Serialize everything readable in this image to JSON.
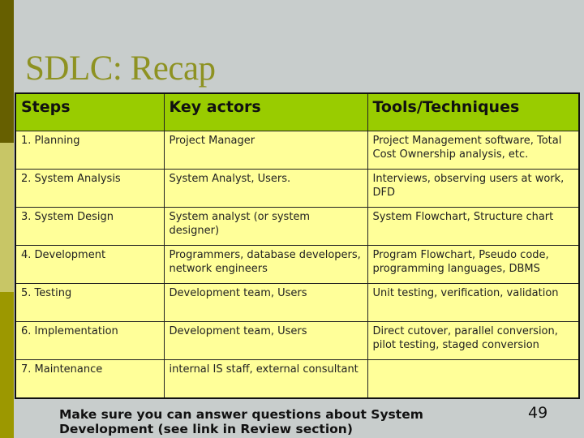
{
  "slide": {
    "title": "SDLC: Recap",
    "page_number": "49",
    "footer_note": "Make sure you can answer questions about System Development  (see link in Review section)",
    "colors": {
      "background": "#c8cdcc",
      "title": "#8e9222",
      "header_row": "#99cc00",
      "body_rows": "#ffff99",
      "strip_top": "#665f00",
      "strip_middle": "#c8c666",
      "strip_bottom": "#9c9800"
    }
  },
  "table": {
    "headers": [
      "Steps",
      "Key actors",
      "Tools/Techniques"
    ],
    "rows": [
      {
        "step": "1. Planning",
        "actors": "Project Manager",
        "tools": "Project Management software, Total Cost Ownership analysis, etc."
      },
      {
        "step": "2. System Analysis",
        "actors": "System Analyst, Users.",
        "tools": "Interviews, observing users at work, DFD"
      },
      {
        "step": "3. System Design",
        "actors": "System analyst (or system designer)",
        "tools": "System Flowchart, Structure chart"
      },
      {
        "step": "4. Development",
        "actors": "Programmers, database developers, network engineers",
        "tools": "Program Flowchart,  Pseudo code, programming languages, DBMS"
      },
      {
        "step": "5. Testing",
        "actors": "Development team, Users",
        "tools": "Unit testing, verification, validation"
      },
      {
        "step": "6. Implementation",
        "actors": "Development team, Users",
        "tools": "Direct cutover, parallel conversion, pilot testing, staged conversion"
      },
      {
        "step": "7. Maintenance",
        "actors": "internal IS staff, external consultant",
        "tools": ""
      }
    ]
  }
}
